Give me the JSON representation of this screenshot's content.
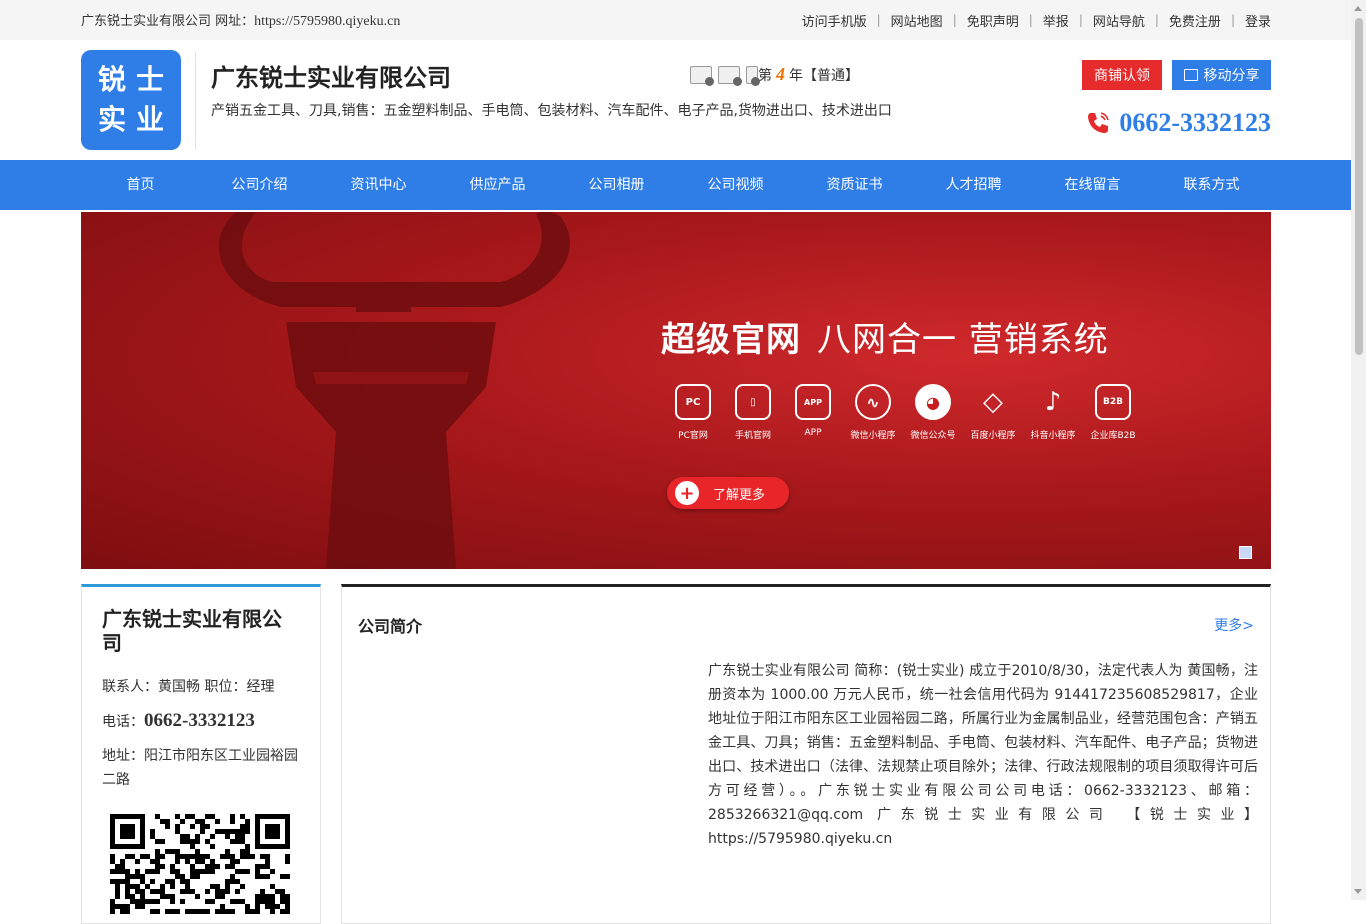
{
  "topbar": {
    "site_label": "广东锐士实业有限公司 网址：",
    "site_url": "https://5795980.qiyeku.cn",
    "links": [
      "访问手机版",
      "网站地图",
      "免职声明",
      "举报",
      "网站导航",
      "免费注册",
      "登录"
    ]
  },
  "header": {
    "logo_chars": [
      "锐",
      "士",
      "实",
      "业"
    ],
    "company_name": "广东锐士实业有限公司",
    "description": "产销五金工具、刀具,销售：五金塑料制品、手电筒、包装材料、汽车配件、电子产品,货物进出口、技术进出口",
    "year_prefix": "第",
    "year_num": "4",
    "year_suffix": "年【普通】",
    "btn_shop": "商铺认领",
    "btn_share": "移动分享",
    "phone": "0662-3332123"
  },
  "nav": [
    "首页",
    "公司介绍",
    "资讯中心",
    "供应产品",
    "公司相册",
    "公司视频",
    "资质证书",
    "人才招聘",
    "在线留言",
    "联系方式"
  ],
  "banner": {
    "title_bold": "超级官网",
    "title_light": "八网合一 营销系统",
    "icons": [
      {
        "label": "PC官网",
        "glyph": "PC"
      },
      {
        "label": "手机官网",
        "glyph": "▯"
      },
      {
        "label": "APP",
        "glyph": "APP"
      },
      {
        "label": "微信小程序",
        "glyph": "∿"
      },
      {
        "label": "微信公众号",
        "glyph": "◕"
      },
      {
        "label": "百度小程序",
        "glyph": "◇"
      },
      {
        "label": "抖音小程序",
        "glyph": "♪"
      },
      {
        "label": "企业库B2B",
        "glyph": "B2B"
      }
    ],
    "learn_more": "了解更多"
  },
  "sidebar": {
    "company_name": "广东锐士实业有限公司",
    "contact_label": "联系人：黄国畅 职位：经理",
    "phone_label": "电话：",
    "phone": "0662-3332123",
    "address": "地址：阳江市阳东区工业园裕园二路"
  },
  "main": {
    "heading": "公司简介",
    "more": "更多>",
    "intro": "广东锐士实业有限公司 简称：(锐士实业) 成立于2010/8/30，法定代表人为 黄国畅，注册资本为 1000.00 万元人民币，统一社会信用代码为 914417235608529817，企业地址位于阳江市阳东区工业园裕园二路，所属行业为金属制品业，经营范围包含：产销五金工具、刀具；销售：五金塑料制品、手电筒、包装材料、汽车配件、电子产品；货物进出口、技术进出口（法律、法规禁止项目除外；法律、行政法规限制的项目须取得许可后方可经营）。。广东锐士实业有限公司公司电话：0662-3332123、邮箱：2853266321@qq.com 广东锐士实业有限公司 【锐士实业】 https://5795980.qiyeku.cn"
  }
}
